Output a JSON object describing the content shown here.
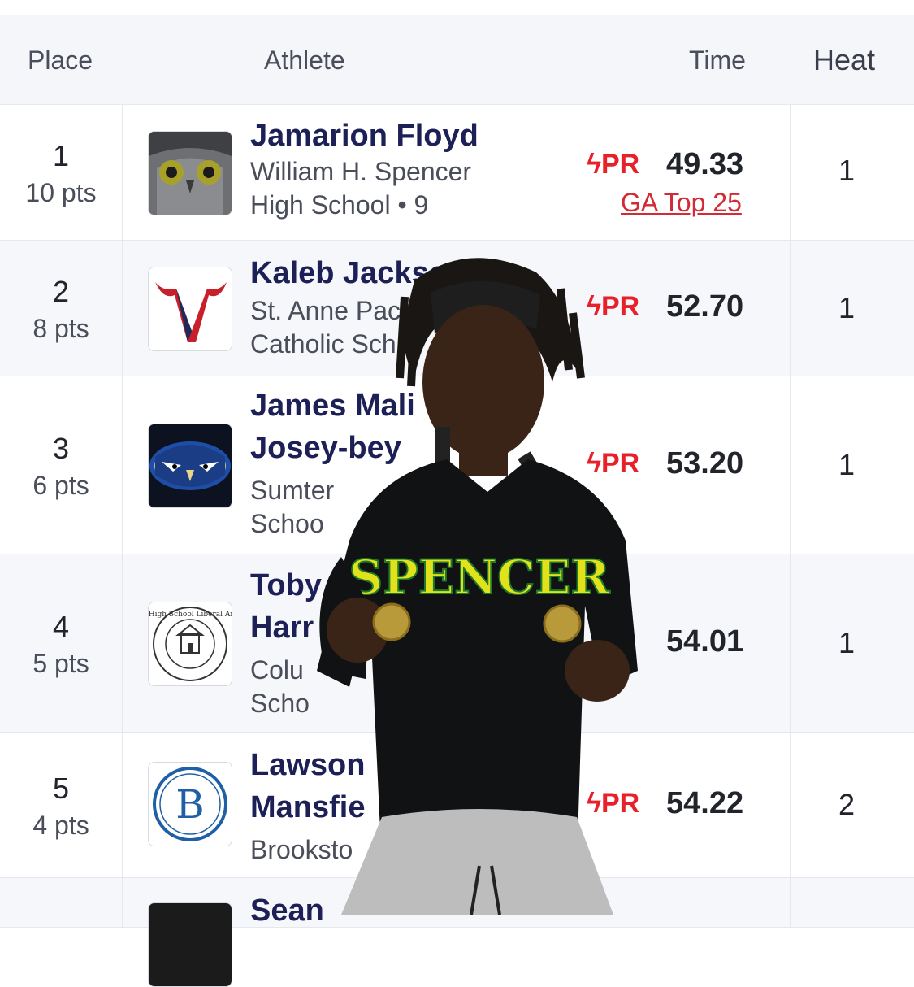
{
  "header": {
    "place": "Place",
    "athlete": "Athlete",
    "time": "Time",
    "heat": "Heat"
  },
  "rows": [
    {
      "place": "1",
      "pts": "10 pts",
      "name": [
        "Jamarion Floyd"
      ],
      "school": [
        "William H. Spencer",
        "High School • 9"
      ],
      "pr": "PR",
      "time": "49.33",
      "note": "GA Top 25",
      "heat": "1"
    },
    {
      "place": "2",
      "pts": "8 pts",
      "name": [
        "Kaleb Jackso"
      ],
      "school": [
        "St. Anne Pac",
        "Catholic Sch"
      ],
      "pr": "PR",
      "time": "52.70",
      "heat": "1"
    },
    {
      "place": "3",
      "pts": "6 pts",
      "name": [
        "James Mali",
        "Josey-bey"
      ],
      "school": [
        "Sumter",
        "Schoo"
      ],
      "pr": "PR",
      "time": "53.20",
      "heat": "1"
    },
    {
      "place": "4",
      "pts": "5 pts",
      "name": [
        "Toby",
        "Harr"
      ],
      "school": [
        "Colu",
        "Scho"
      ],
      "time": "54.01",
      "heat": "1"
    },
    {
      "place": "5",
      "pts": "4 pts",
      "name": [
        "Lawson",
        "Mansfie"
      ],
      "school": [
        "Brooksto"
      ],
      "pr": "PR",
      "time": "54.22",
      "heat": "2"
    },
    {
      "name": [
        "Sean"
      ]
    }
  ],
  "logos": {
    "row1": "owl-icon",
    "row2": "bull-v-logo",
    "row3": "hawk-logo",
    "row4": "columbus-high-seal",
    "row5": "b-logo",
    "row6": "school-logo"
  },
  "logo_text": {
    "row4_seal": "Columbus High School Liberal Arts Magnet",
    "row5_letter": "B"
  },
  "overlay": {
    "shirt_text": "SPENCER"
  },
  "colors": {
    "name": "#1d2056",
    "pr": "#e8202a",
    "link": "#d42a35",
    "header_bg": "#f5f6f9",
    "alt_row": "#f6f7fa",
    "shirt_text": "#e2e21a"
  }
}
